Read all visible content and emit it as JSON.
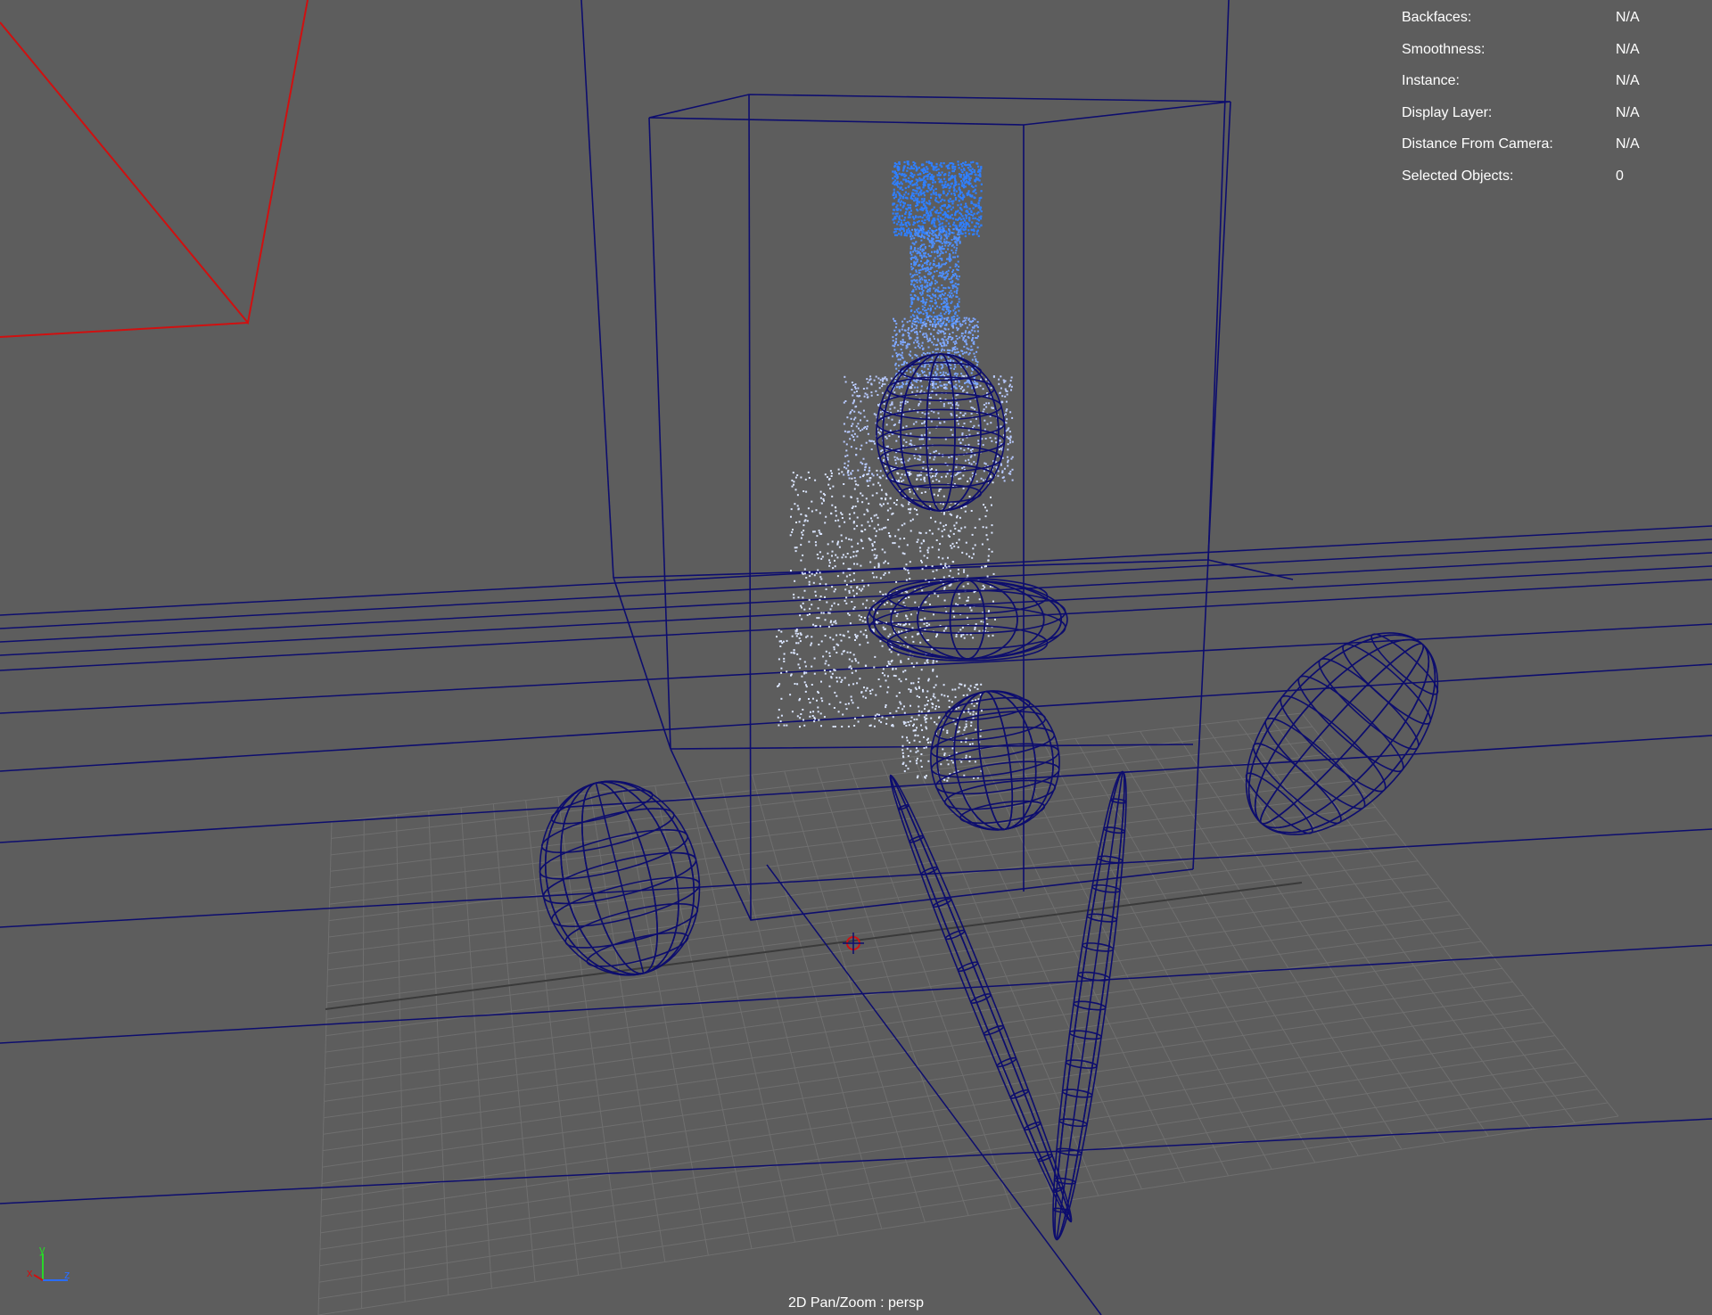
{
  "hud": {
    "rows": [
      {
        "label": "Backfaces:",
        "value": "N/A"
      },
      {
        "label": "Smoothness:",
        "value": "N/A"
      },
      {
        "label": "Instance:",
        "value": "N/A"
      },
      {
        "label": "Display Layer:",
        "value": "N/A"
      },
      {
        "label": "Distance From Camera:",
        "value": "N/A"
      },
      {
        "label": "Selected Objects:",
        "value": "0"
      }
    ]
  },
  "footer": {
    "camera_label": "2D Pan/Zoom : persp"
  },
  "axis": {
    "x": "x",
    "y": "y",
    "z": "z"
  },
  "colors": {
    "background": "#5d5d5d",
    "wireframe": "#0d0d6e",
    "grid": "#6f6f6f",
    "camera_frustum": "#d01010",
    "particle_dense": "#2f7fff",
    "particle_light": "#dbe6ff",
    "hud_text": "#ffffff"
  }
}
